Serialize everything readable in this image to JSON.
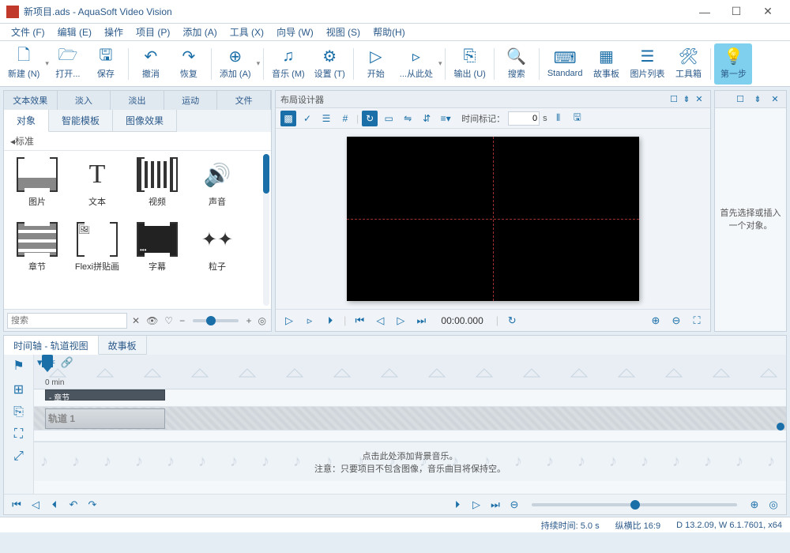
{
  "window": {
    "title": "新项目.ads - AquaSoft Video Vision"
  },
  "menu": {
    "items": [
      "文件 (F)",
      "编辑 (E)",
      "操作",
      "项目 (P)",
      "添加 (A)",
      "工具 (X)",
      "向导 (W)",
      "视图 (S)",
      "帮助(H)"
    ]
  },
  "ribbon": {
    "new": "新建 (N)",
    "open": "打开...",
    "save": "保存",
    "undo": "撤消",
    "redo": "恢复",
    "add": "添加 (A)",
    "music": "音乐 (M)",
    "settings": "设置 (T)",
    "start": "开始",
    "fromhere": "...从此处",
    "output": "输出 (U)",
    "search": "搜索",
    "standard": "Standard",
    "storyboard": "故事板",
    "imagelist": "图片列表",
    "toolbox": "工具箱",
    "firststep": "第一步"
  },
  "left": {
    "tabs1": [
      "文本效果",
      "淡入",
      "淡出",
      "运动",
      "文件"
    ],
    "tabs2": [
      "对象",
      "智能模板",
      "图像效果"
    ],
    "category": "标准",
    "objects": {
      "image": "图片",
      "text": "文本",
      "video": "视频",
      "sound": "声音",
      "chapter": "章节",
      "flexi": "Flexi拼贴画",
      "subtitle": "字幕",
      "particle": "粒子"
    },
    "search_placeholder": "搜索"
  },
  "center": {
    "title": "布局设计器",
    "timemark_label": "时间标记：",
    "timemark_value": "0",
    "timemark_unit": "s",
    "play_time": "00:00.000"
  },
  "right": {
    "message": "首先选择或插入一个对象。"
  },
  "timeline": {
    "tabs": [
      "时间轴 - 轨道视图",
      "故事板"
    ],
    "zero": "0 min",
    "chapter_clip": "- 章节",
    "track1": "轨道 1",
    "music_hint1": "点击此处添加背景音乐。",
    "music_hint2": "注意：只要项目不包含图像，音乐曲目将保持空。"
  },
  "status": {
    "duration": "持续时间: 5.0 s",
    "aspect": "纵横比 16:9",
    "version": "D 13.2.09, W 6.1.7601, x64"
  }
}
